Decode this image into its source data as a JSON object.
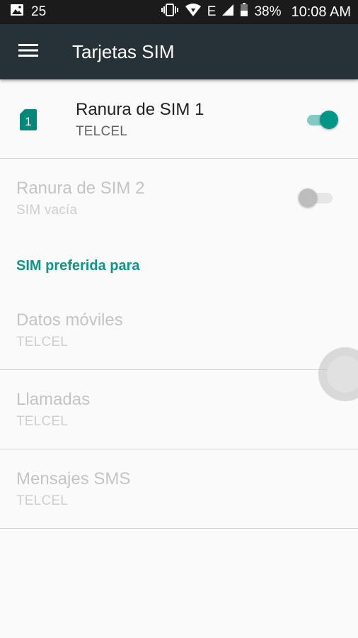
{
  "status_bar": {
    "notification_count": "25",
    "network_type": "E",
    "battery": "38%",
    "time": "10:08 AM"
  },
  "app_bar": {
    "title": "Tarjetas SIM",
    "menu_icon": "hamburger-menu-icon"
  },
  "sim_slots": [
    {
      "title": "Ranura de SIM 1",
      "summary": "TELCEL",
      "sim_number": "1",
      "enabled": true,
      "switch_on": true
    },
    {
      "title": "Ranura de SIM 2",
      "summary": "SIM vacía",
      "enabled": false,
      "switch_on": false
    }
  ],
  "preferred": {
    "category_title": "SIM preferida para",
    "items": [
      {
        "title": "Datos móviles",
        "summary": "TELCEL"
      },
      {
        "title": "Llamadas",
        "summary": "TELCEL"
      },
      {
        "title": "Mensajes SMS",
        "summary": "TELCEL"
      }
    ]
  },
  "colors": {
    "accent": "#009688",
    "app_bar": "#263238",
    "status_bar": "#1b1b1b"
  }
}
